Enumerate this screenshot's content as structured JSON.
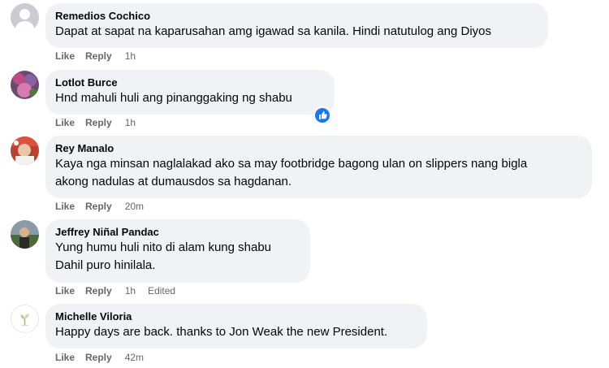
{
  "comments": [
    {
      "name": "Remedios Cochico",
      "lines": [
        "Dapat at sapat na kaparusahan amg igawad sa kanila. Hindi natutulog ang Diyos"
      ],
      "like": "Like",
      "reply": "Reply",
      "time": "1h",
      "edited": "",
      "avatar": "default-avatar"
    },
    {
      "name": "Lotlot Burce",
      "lines": [
        "Hnd mahuli huli ang pinanggaking ng shabu"
      ],
      "like": "Like",
      "reply": "Reply",
      "time": "1h",
      "edited": "",
      "avatar": "photo-avatar",
      "reaction": "like-reaction-icon"
    },
    {
      "name": "Rey Manalo",
      "lines": [
        "Kaya nga minsan naglalakad ako sa may footbridge bagong ulan on slippers nang bigla",
        "akong nadulas at dumausdos sa hagdanan."
      ],
      "like": "Like",
      "reply": "Reply",
      "time": "20m",
      "edited": "",
      "avatar": "photo-avatar"
    },
    {
      "name": "Jeffrey Niñal Pandac",
      "lines": [
        "Yung humu huli nito di alam kung shabu",
        "Dahil puro hinilala."
      ],
      "like": "Like",
      "reply": "Reply",
      "time": "1h",
      "edited": "Edited",
      "avatar": "photo-avatar"
    },
    {
      "name": "Michelle Viloria",
      "lines": [
        "Happy days are back. thanks to Jon Weak the new President."
      ],
      "like": "Like",
      "reply": "Reply",
      "time": "42m",
      "edited": "",
      "avatar": "sprout-avatar"
    }
  ],
  "colors": {
    "bubble_bg": "#f0f2f5",
    "meta_text": "#65676b",
    "like_blue": "#1877f2"
  }
}
